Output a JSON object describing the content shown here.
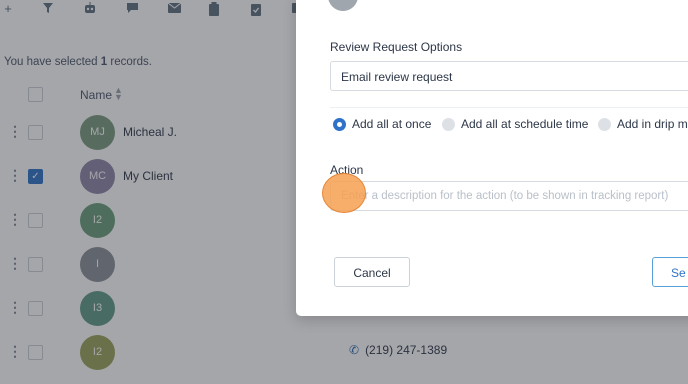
{
  "colors": {
    "accent": "#2e73c7",
    "overlay": "rgba(40,44,52,0.42)",
    "click_marker": "#f5a050"
  },
  "toolbar": {
    "icons": [
      "add-icon",
      "filter-icon",
      "robot-icon",
      "chat-icon",
      "mail-icon",
      "clipboard-icon",
      "clipboard-check-icon",
      "more-icon"
    ]
  },
  "selection": {
    "prefix": "You have selected ",
    "count": "1",
    "suffix": " records."
  },
  "table": {
    "name_header": "Name",
    "rows": [
      {
        "initials": "MJ",
        "name": "Micheal J.",
        "checked": false,
        "avatar_color": "#7a9a7e"
      },
      {
        "initials": "MC",
        "name": "My Client",
        "checked": true,
        "avatar_color": "#8c85a6"
      },
      {
        "initials": "I2",
        "name": "",
        "checked": false,
        "avatar_color": "#6a9e7a"
      },
      {
        "initials": "I",
        "name": "",
        "checked": false,
        "avatar_color": "#8a8f96"
      },
      {
        "initials": "I3",
        "name": "",
        "checked": false,
        "avatar_color": "#5f9c86"
      },
      {
        "initials": "I2",
        "name": "",
        "checked": false,
        "avatar_color": "#9aa35a"
      }
    ],
    "phone": "(219) 247-1389"
  },
  "modal": {
    "review_request_label": "Review Request Options",
    "review_request_value": "Email review request",
    "radio_options": [
      {
        "label": "Add all at once",
        "selected": true
      },
      {
        "label": "Add all at schedule time",
        "selected": false
      },
      {
        "label": "Add in drip mo",
        "selected": false
      }
    ],
    "action_label": "Action",
    "action_placeholder": "Enter a description for the action (to be shown in tracking report)",
    "cancel_label": "Cancel",
    "send_label": "Se"
  }
}
